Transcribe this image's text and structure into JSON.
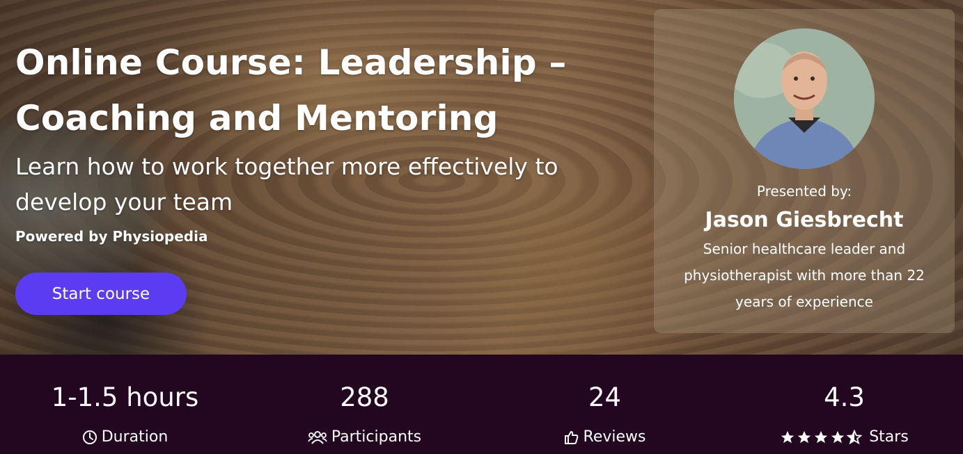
{
  "hero": {
    "title": "Online Course: Leadership – Coaching and Mentoring",
    "subtitle": "Learn how to work together more effectively to develop your team",
    "powered_by": "Powered by Physiopedia",
    "start_button": "Start course"
  },
  "presenter": {
    "presented_by_label": "Presented by:",
    "name": "Jason Giesbrecht",
    "bio": "Senior healthcare leader and physiotherapist with more than 22 years of experience"
  },
  "stats": [
    {
      "value": "1-1.5 hours",
      "label": "Duration",
      "icon": "clock-icon"
    },
    {
      "value": "288",
      "label": "Participants",
      "icon": "users-icon"
    },
    {
      "value": "24",
      "label": "Reviews",
      "icon": "thumbs-up-icon"
    },
    {
      "value": "4.3",
      "label": "Stars",
      "icon": "star-rating-icon",
      "rating": 4.5
    }
  ],
  "colors": {
    "accent": "#5c3cf0",
    "stats_background": "#23061f"
  }
}
